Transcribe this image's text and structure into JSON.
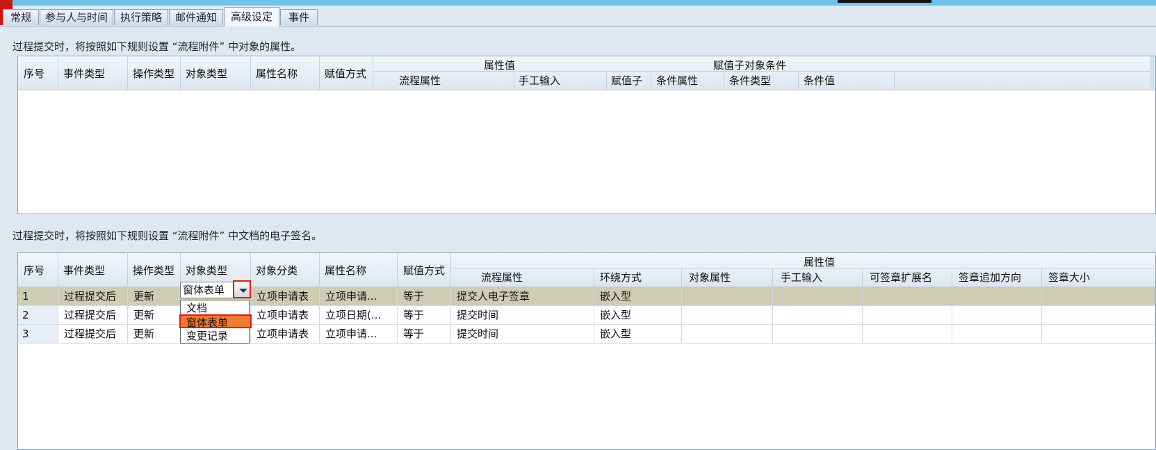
{
  "tabs": [
    "常规",
    "参与人与时间",
    "执行策略",
    "邮件通知",
    "高级设定",
    "事件"
  ],
  "active_tab": "高级设定",
  "section1": {
    "caption": "过程提交时，将按照如下规则设置 “流程附件” 中对象的属性。",
    "headers": {
      "seq": "序号",
      "event_type": "事件类型",
      "op_type": "操作类型",
      "obj_type": "对象类型",
      "attr_name": "属性名称",
      "assign_mode": "赋值方式",
      "attr_value": "属性值",
      "flow_attr": "流程属性",
      "manual_input": "手工输入",
      "assign_sub": "赋值子",
      "sub_cond": "赋值子对象条件",
      "cond_attr": "条件属性",
      "cond_type": "条件类型",
      "cond_value": "条件值"
    }
  },
  "section2": {
    "caption": "过程提交时，将按照如下规则设置 “流程附件” 中文档的电子签名。",
    "headers": {
      "seq": "序号",
      "event_type": "事件类型",
      "op_type": "操作类型",
      "obj_type": "对象类型",
      "obj_class": "对象分类",
      "attr_name": "属性名称",
      "assign_mode": "赋值方式",
      "attr_value": "属性值",
      "flow_attr": "流程属性",
      "embed_mode": "环绕方式",
      "obj_attr": "对象属性",
      "manual_input": "手工输入",
      "ext_name": "可签章扩展名",
      "append_dir": "签章追加方向",
      "sig_size": "签章大小"
    },
    "rows": [
      {
        "seq": "1",
        "event": "过程提交后",
        "op": "更新",
        "obj_type": "窗体表单",
        "obj_class": "立项申请表",
        "attr": "立项申请...",
        "mode": "等于",
        "flow_attr": "提交人电子签章",
        "embed": "嵌入型"
      },
      {
        "seq": "2",
        "event": "过程提交后",
        "op": "更新",
        "obj_type": "",
        "obj_class": "立项申请表",
        "attr": "立项日期(...",
        "mode": "等于",
        "flow_attr": "提交时间",
        "embed": "嵌入型"
      },
      {
        "seq": "3",
        "event": "过程提交后",
        "op": "更新",
        "obj_type": "",
        "obj_class": "立项申请表",
        "attr": "立项申请...",
        "mode": "等于",
        "flow_attr": "提交时间",
        "embed": "嵌入型"
      }
    ],
    "editor_value": "窗体表单",
    "dropdown_options": [
      "文档",
      "窗体表单",
      "变更记录"
    ],
    "dropdown_selected": "窗体表单"
  }
}
